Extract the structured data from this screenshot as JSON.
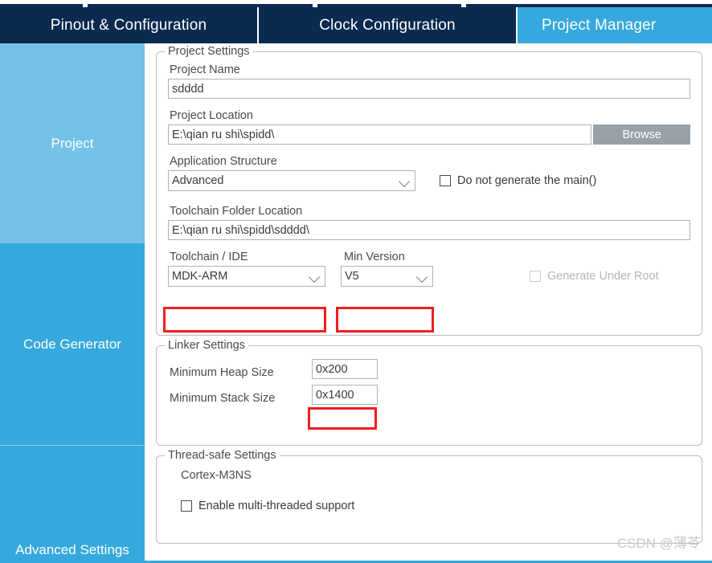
{
  "tabs": [
    {
      "label": "Pinout & Configuration",
      "active": false
    },
    {
      "label": "Clock Configuration",
      "active": false
    },
    {
      "label": "Project Manager",
      "active": true
    }
  ],
  "sidebar": {
    "items": [
      {
        "label": "Project"
      },
      {
        "label": "Code Generator"
      },
      {
        "label": "Advanced Settings"
      }
    ]
  },
  "project_settings": {
    "legend": "Project Settings",
    "project_name_label": "Project Name",
    "project_name_value": "sdddd",
    "project_location_label": "Project Location",
    "project_location_value": "E:\\qian ru shi\\spidd\\",
    "browse_label": "Browse",
    "application_structure_label": "Application Structure",
    "application_structure_value": "Advanced",
    "do_not_generate_main_label": "Do not generate the main()",
    "toolchain_folder_label": "Toolchain Folder Location",
    "toolchain_folder_value": "E:\\qian ru shi\\spidd\\sdddd\\",
    "toolchain_ide_label": "Toolchain / IDE",
    "toolchain_ide_value": "MDK-ARM",
    "min_version_label": "Min Version",
    "min_version_value": "V5",
    "generate_under_root_label": "Generate Under Root"
  },
  "linker_settings": {
    "legend": "Linker Settings",
    "min_heap_label": "Minimum Heap Size",
    "min_heap_value": "0x200",
    "min_stack_label": "Minimum Stack Size",
    "min_stack_value": "0x1400"
  },
  "thread_safe_settings": {
    "legend": "Thread-safe Settings",
    "core_label": "Cortex-M3NS",
    "enable_multithread_label": "Enable multi-threaded support"
  },
  "watermark": "CSDN @薄苓",
  "colors": {
    "tab_bar": "#0a2a4f",
    "accent": "#35a8dd",
    "accent_light": "#74c2e8",
    "annotation": "#f01e1e",
    "browse_button": "#9aa0a8"
  }
}
